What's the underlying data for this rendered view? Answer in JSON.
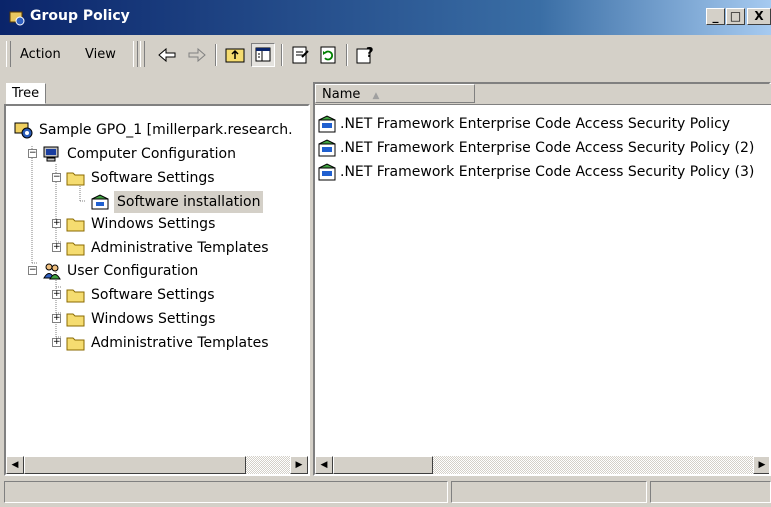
{
  "window": {
    "title": "Group Policy"
  },
  "caption_buttons": {
    "minimize": "_",
    "maximize": "□",
    "close": "X"
  },
  "menu": {
    "action": "Action",
    "view": "View"
  },
  "toolbar": {
    "icons": [
      "back-arrow-icon",
      "forward-arrow-icon",
      "up-folder-icon",
      "show-hide-tree-icon",
      "properties-icon",
      "refresh-icon",
      "help-icon"
    ]
  },
  "tree": {
    "tab_label": "Tree",
    "items": [
      {
        "label": "Sample GPO_1 [millerpark.research.",
        "icon": "gpo-icon"
      },
      {
        "label": "Computer Configuration",
        "icon": "computer-icon"
      },
      {
        "label": "Software Settings",
        "icon": "folder-icon"
      },
      {
        "label": "Software installation",
        "icon": "software-install-icon",
        "selected": true
      },
      {
        "label": "Windows Settings",
        "icon": "folder-icon"
      },
      {
        "label": "Administrative Templates",
        "icon": "folder-icon"
      },
      {
        "label": "User Configuration",
        "icon": "users-icon"
      },
      {
        "label": "Software Settings",
        "icon": "folder-icon"
      },
      {
        "label": "Windows Settings",
        "icon": "folder-icon"
      },
      {
        "label": "Administrative Templates",
        "icon": "folder-icon"
      }
    ]
  },
  "list": {
    "column_name": "Name",
    "sort_indicator": "▲",
    "items": [
      {
        "name": ".NET Framework Enterprise Code Access Security Policy",
        "icon": "msi-package-icon"
      },
      {
        "name": ".NET Framework Enterprise Code Access Security Policy (2)",
        "icon": "msi-package-icon"
      },
      {
        "name": ".NET Framework Enterprise Code Access Security Policy (3)",
        "icon": "msi-package-icon"
      }
    ]
  },
  "colors": {
    "title_gradient_start": "#0a246a",
    "title_gradient_end": "#a6caf0",
    "face": "#d4d0c8"
  }
}
